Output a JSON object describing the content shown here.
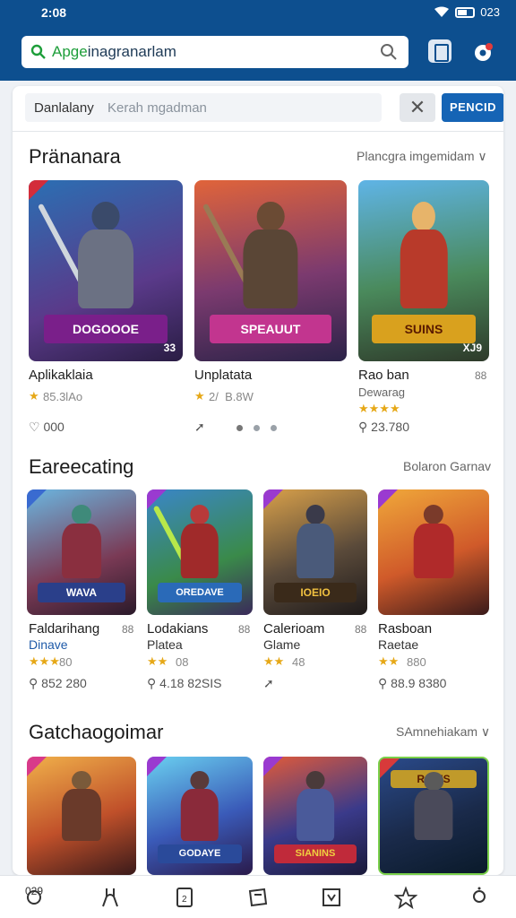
{
  "status": {
    "time": "2:08",
    "battery_text": "023"
  },
  "search": {
    "green_text": "Apge",
    "text": "inagranarlam"
  },
  "filter": {
    "label": "Danlalany",
    "placeholder": "Kerah mgadman",
    "button": "PENCID"
  },
  "sections": [
    {
      "title": "Pränanara",
      "link": "Plancgra imgemidam ∨",
      "items": [
        {
          "name": "Aplikaklaia",
          "rating": "★",
          "meta": "85.3lAo",
          "stat": "000",
          "stat_icon": "heart-icon",
          "banner": "DOGOOOE",
          "num": "33"
        },
        {
          "name": "Unplatata",
          "rating": "★",
          "meta": "2/  B.8W",
          "stat": "",
          "stat_icon": "share-icon",
          "banner": "SPEAUUT",
          "num": ""
        },
        {
          "name": "Rao ban",
          "sub": "Dewarag",
          "rating": "★★★★",
          "meta": "",
          "stat": "23.780",
          "stat_icon": "search-icon",
          "extra": "88",
          "banner": "SUINS",
          "num": "XJ9"
        }
      ]
    },
    {
      "title": "Eareecating",
      "link": "Bolaron Garnav",
      "items": [
        {
          "name": "Faldarihang",
          "sub": "Dinave",
          "rating": "★★★",
          "meta": "80",
          "stat": "852 280",
          "extra": "88",
          "banner": "WAVA"
        },
        {
          "name": "Lodakians",
          "sub": "Platea",
          "rating": "★★",
          "meta": "08",
          "stat": "4.18 82SIS",
          "extra": "88",
          "banner": "OREDAVE"
        },
        {
          "name": "Calerioam",
          "sub": "Glame",
          "rating": "★★",
          "meta": "48",
          "stat": "",
          "extra": "88",
          "banner": "IOEIO"
        },
        {
          "name": "Rasboan",
          "sub": "Raetae",
          "rating": "★★",
          "meta": "880",
          "stat": "88.9 8380",
          "extra": "",
          "banner": ""
        }
      ]
    },
    {
      "title": "Gatchaogoimar",
      "link": "SAmnehiakam ∨",
      "items": [
        {
          "banner": ""
        },
        {
          "banner": "GODAYE"
        },
        {
          "banner": "SIANINS"
        },
        {
          "banner": "RAINS"
        }
      ]
    }
  ],
  "nav": [
    {
      "icon": "home-icon",
      "label": "029"
    },
    {
      "icon": "tools-icon",
      "label": ""
    },
    {
      "icon": "library-icon",
      "label": ""
    },
    {
      "icon": "cart-icon",
      "label": ""
    },
    {
      "icon": "chart-icon",
      "label": ""
    },
    {
      "icon": "star-icon",
      "label": ""
    },
    {
      "icon": "profile-icon",
      "label": ""
    }
  ]
}
